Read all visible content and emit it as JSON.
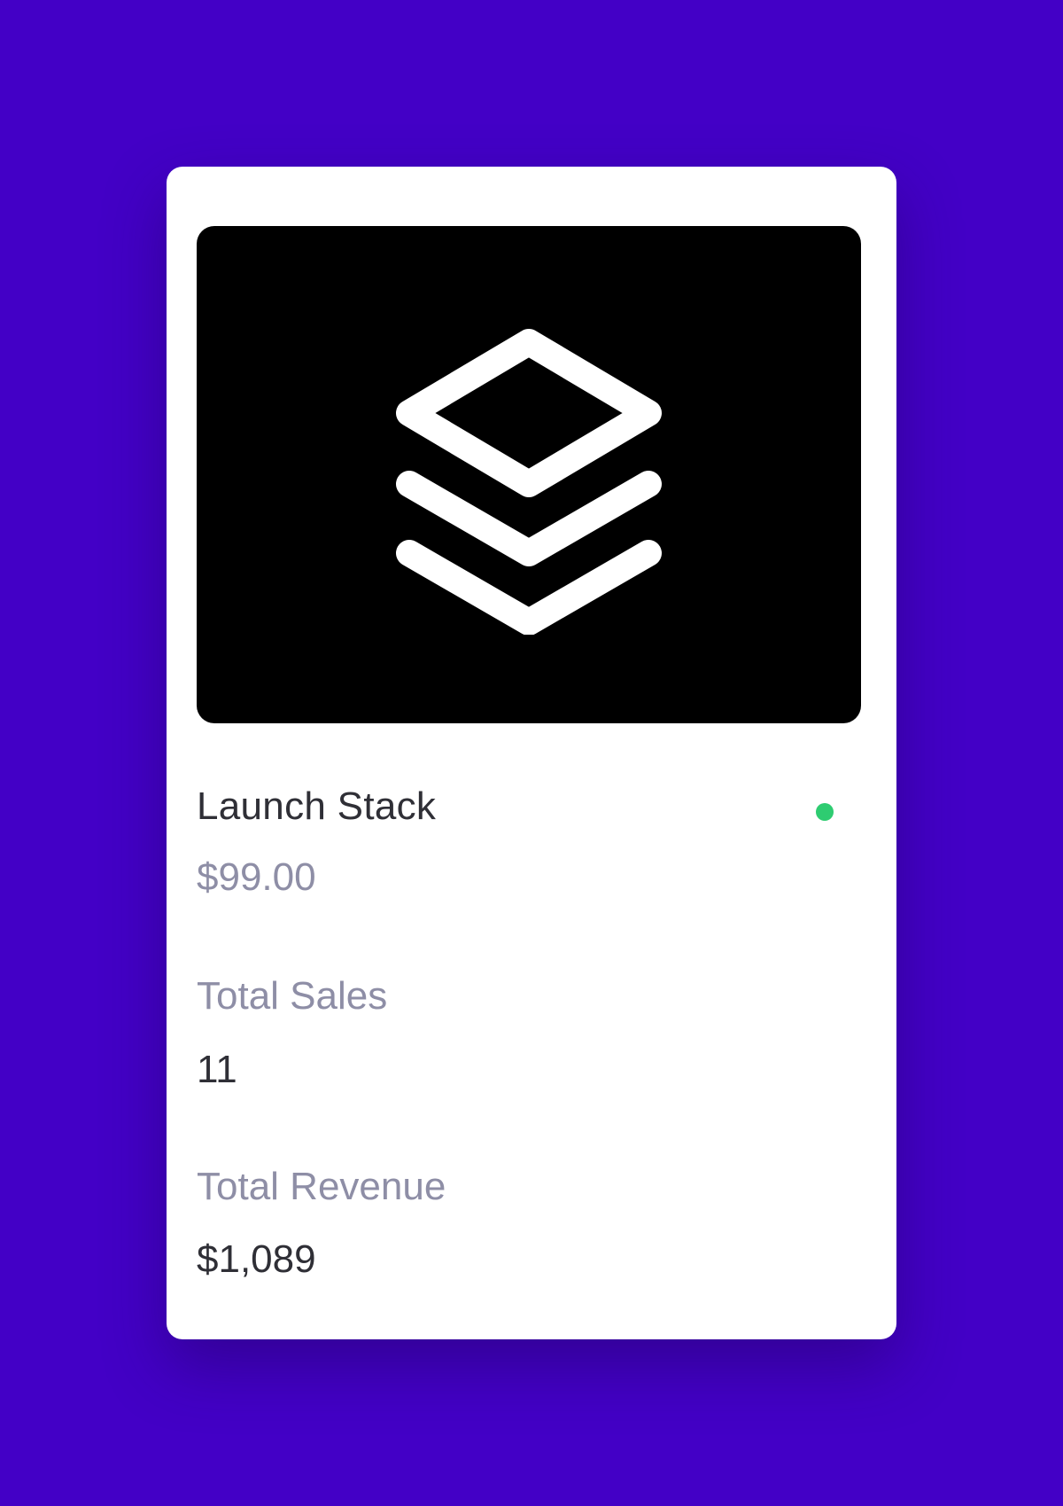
{
  "product": {
    "name": "Launch Stack",
    "price": "$99.00",
    "status_color": "#2ecc71",
    "thumbnail_icon": "layers-icon",
    "thumbnail_background": "#000000"
  },
  "stats": {
    "sales_label": "Total Sales",
    "sales_value": "11",
    "revenue_label": "Total Revenue",
    "revenue_value": "$1,089"
  },
  "colors": {
    "background": "#4300c6",
    "card": "#ffffff",
    "muted_text": "#8e8ea6",
    "primary_text": "#2f2f36"
  }
}
